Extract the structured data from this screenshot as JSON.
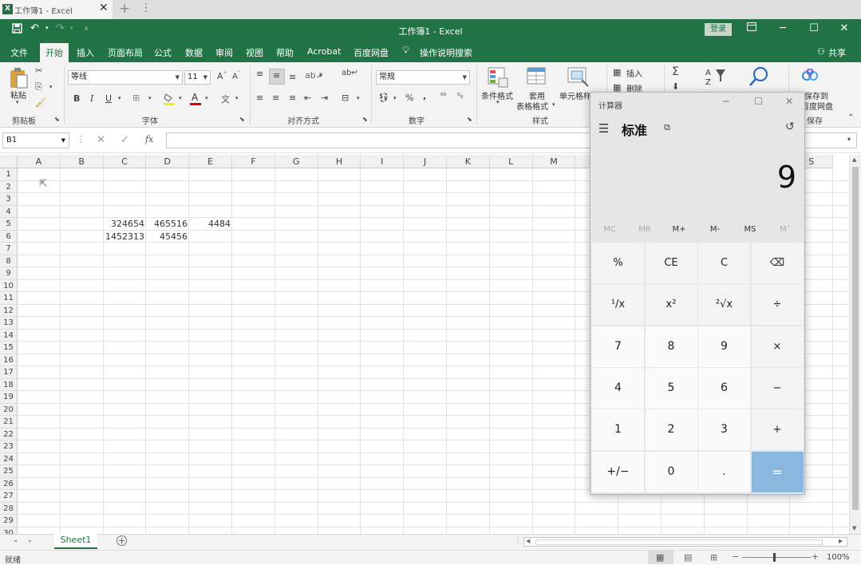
{
  "browser": {
    "tab_title": "工作簿1 - Excel",
    "close": "✕",
    "new_tab": "+",
    "more": "⋮"
  },
  "titlebar": {
    "title": "工作簿1 - Excel",
    "login": "登录"
  },
  "menu": [
    "文件",
    "开始",
    "插入",
    "页面布局",
    "公式",
    "数据",
    "审阅",
    "视图",
    "帮助",
    "Acrobat",
    "百度网盘",
    "操作说明搜索"
  ],
  "share": "共享",
  "ribbon": {
    "paste": "粘贴",
    "font_name": "等线",
    "font_size": "11",
    "number_format": "常规",
    "insert": "插入",
    "delete": "删除",
    "cond_format": "条件格式",
    "table_format_1": "套用",
    "table_format_2": "表格格式",
    "cell_style": "单元格样式",
    "save_to_1": "保存到",
    "save_to_2": "百度网盘",
    "groups": [
      "剪贴板",
      "字体",
      "对齐方式",
      "数字",
      "样式",
      "保存"
    ]
  },
  "namebox": "B1",
  "fx": "fx",
  "columns": [
    "A",
    "B",
    "C",
    "D",
    "E",
    "F",
    "G",
    "H",
    "I",
    "J",
    "K",
    "L",
    "M",
    "N",
    "O",
    "P",
    "Q",
    "R",
    "S"
  ],
  "rows": [
    "1",
    "2",
    "3",
    "4",
    "5",
    "6",
    "7",
    "8",
    "9",
    "10",
    "11",
    "12",
    "13",
    "14",
    "15",
    "16",
    "17",
    "18",
    "19",
    "20",
    "21",
    "22",
    "23",
    "24",
    "25",
    "26",
    "27",
    "28",
    "29",
    "30"
  ],
  "cells": {
    "C5": "324654",
    "D5": "465516",
    "E5": "4484",
    "C6": "1452313",
    "D6": "45456"
  },
  "sheet": "Sheet1",
  "status": {
    "ready": "就绪",
    "zoom": "100%"
  },
  "calculator": {
    "window_title": "计算器",
    "mode": "标准",
    "display": "9",
    "memory": [
      "MC",
      "MR",
      "M+",
      "M-",
      "MS",
      "M˅"
    ],
    "keys": [
      [
        "%",
        "CE",
        "C",
        "⌫"
      ],
      [
        "¹/x",
        "x²",
        "²√x",
        "÷"
      ],
      [
        "7",
        "8",
        "9",
        "×"
      ],
      [
        "4",
        "5",
        "6",
        "−"
      ],
      [
        "1",
        "2",
        "3",
        "+"
      ],
      [
        "+/−",
        "0",
        ".",
        "="
      ]
    ]
  }
}
